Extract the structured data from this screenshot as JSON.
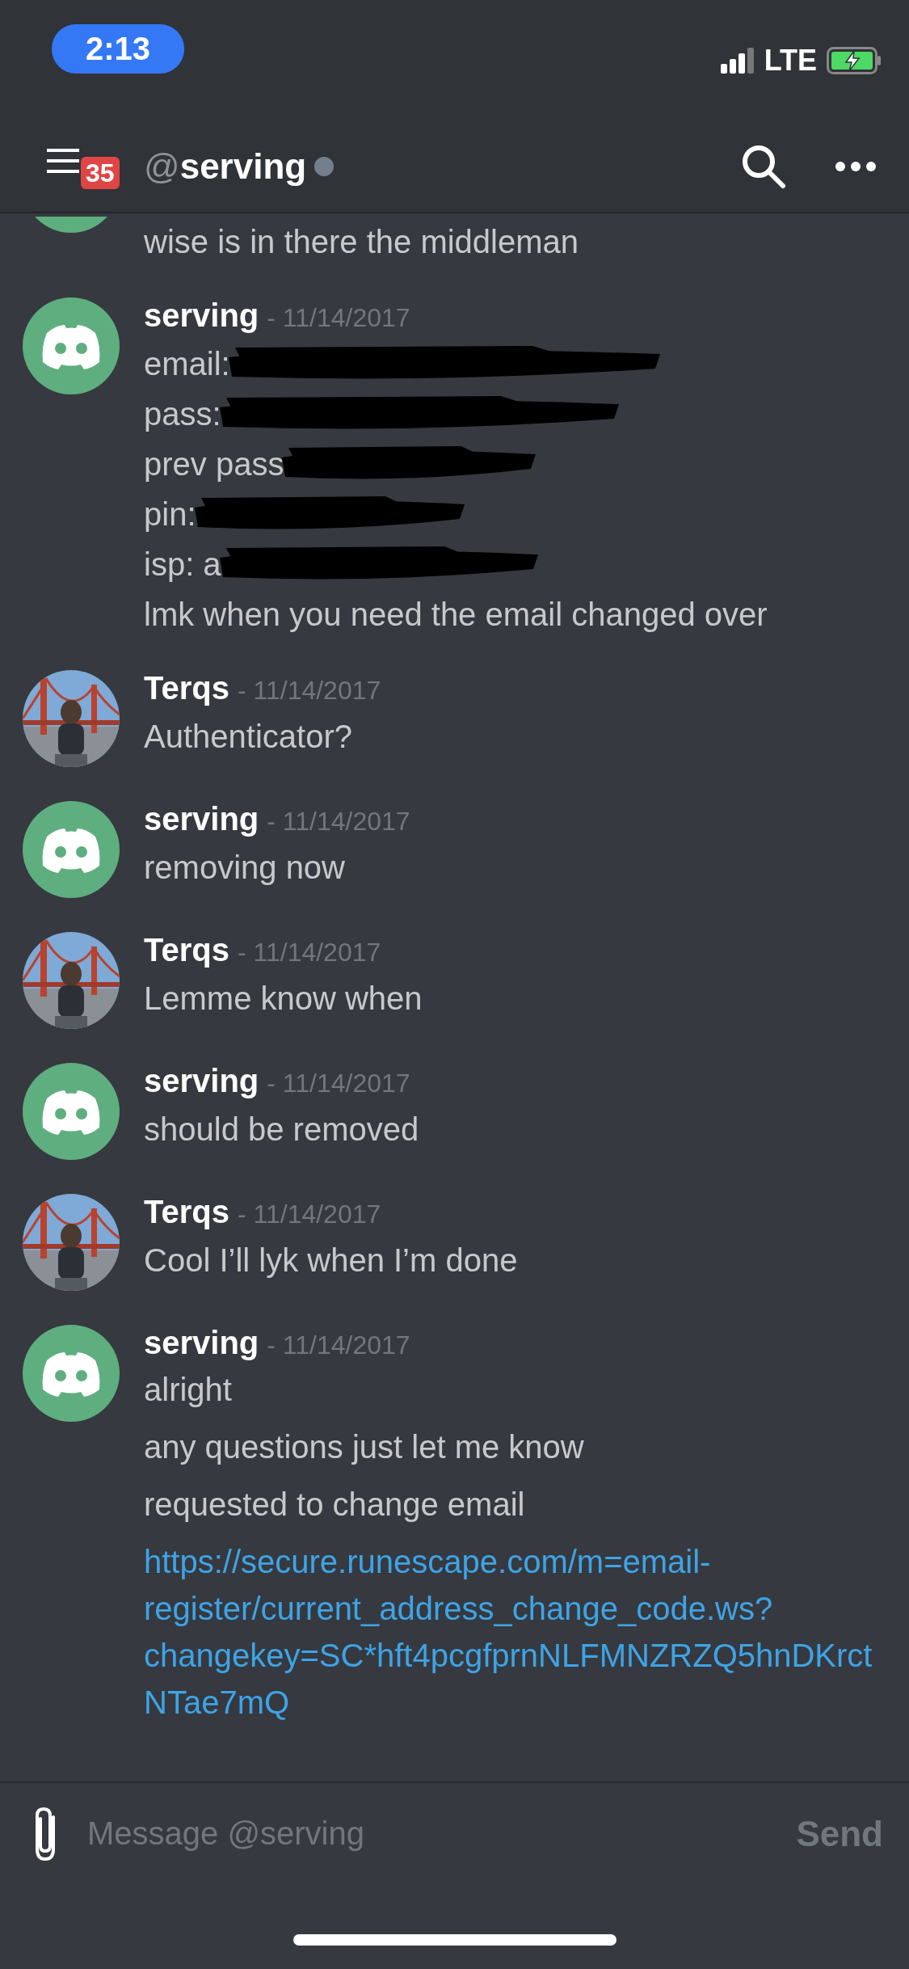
{
  "status_bar": {
    "time": "2:13",
    "network": "LTE"
  },
  "header": {
    "badge": "35",
    "at": "@",
    "channel": "serving",
    "online": false
  },
  "messages": [
    {
      "kind": "continuation",
      "avatar": {
        "kind": "logo"
      },
      "lines": [
        {
          "kind": "text",
          "text": "wise is in there the middleman"
        }
      ]
    },
    {
      "kind": "message",
      "avatar": {
        "kind": "logo"
      },
      "author": "serving",
      "date": "- 11/14/2017",
      "lines": [
        {
          "kind": "text",
          "text": "email:",
          "redacted": true
        },
        {
          "kind": "text",
          "text": "pass:",
          "redacted": true
        },
        {
          "kind": "text",
          "text": "prev pass",
          "redacted": true
        },
        {
          "kind": "text",
          "text": "pin:",
          "redacted": true
        },
        {
          "kind": "text",
          "text": "isp: a",
          "redacted": true
        },
        {
          "kind": "text",
          "text": "lmk when you need the email changed over",
          "redacted": false
        }
      ]
    },
    {
      "kind": "message",
      "author": "Terqs",
      "date": "- 11/14/2017",
      "lines": [
        {
          "kind": "text",
          "text": "Authenticator?"
        }
      ]
    },
    {
      "kind": "message",
      "avatar": {
        "kind": "logo"
      },
      "author": "serving",
      "date": "- 11/14/2017",
      "lines": [
        {
          "kind": "text",
          "text": "removing now"
        }
      ]
    },
    {
      "kind": "message",
      "author": "Terqs",
      "date": "- 11/14/2017",
      "lines": [
        {
          "kind": "text",
          "text": "Lemme know when"
        }
      ]
    },
    {
      "kind": "message",
      "avatar": {
        "kind": "logo"
      },
      "author": "serving",
      "date": "- 11/14/2017",
      "lines": [
        {
          "kind": "text",
          "text": "should be removed"
        }
      ]
    },
    {
      "kind": "message",
      "author": "Terqs",
      "date": "- 11/14/2017",
      "lines": [
        {
          "kind": "text",
          "text": "Cool I’ll lyk when I’m done"
        }
      ]
    },
    {
      "kind": "message",
      "avatar": {
        "kind": "logo"
      },
      "author": "serving",
      "date": "- 11/14/2017",
      "lines": [
        {
          "kind": "para",
          "text": "alright"
        },
        {
          "kind": "para",
          "text": "any questions just let me know"
        },
        {
          "kind": "para",
          "text": "requested to change email"
        },
        {
          "kind": "link",
          "text": "https://secure.runescape.com/m=email-register/current_address_change_code.ws?changekey=SC*hft4pcgfprnNLFMNZRZQ5hnDKrctNTae7mQ"
        }
      ]
    }
  ],
  "composer": {
    "placeholder": "Message @serving",
    "send": "Send"
  }
}
